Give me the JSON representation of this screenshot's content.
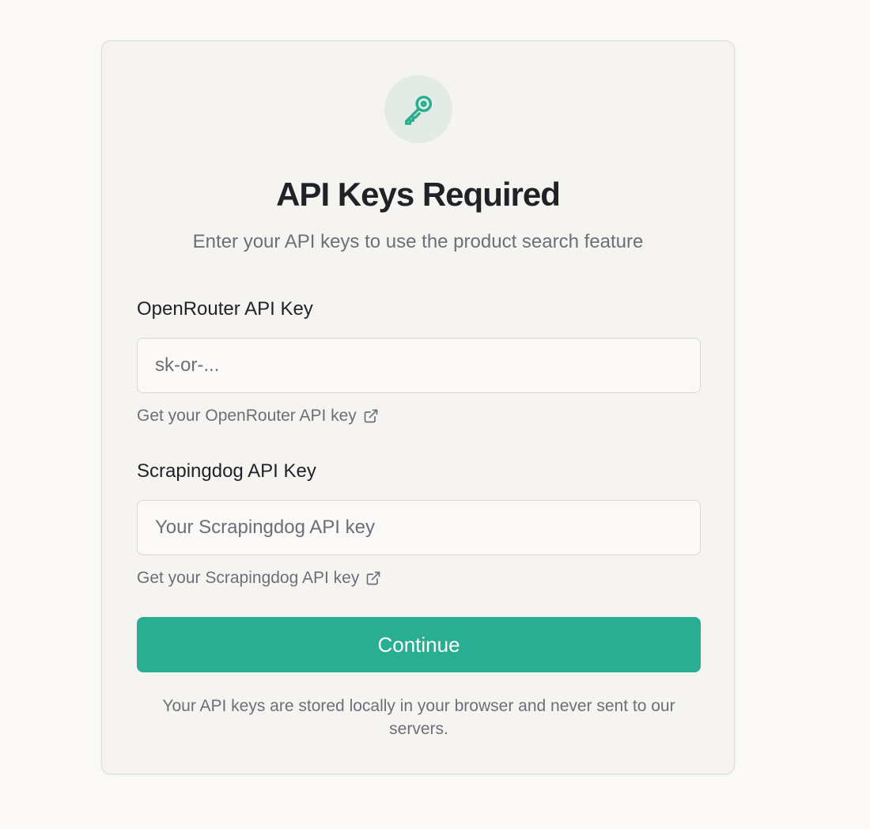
{
  "dialog": {
    "icon": "key-icon",
    "title": "API Keys Required",
    "subtitle": "Enter your API keys to use the product search feature"
  },
  "openrouter": {
    "label": "OpenRouter API Key",
    "value": "",
    "placeholder": "sk-or-...",
    "link_text": "Get your OpenRouter API key",
    "link_icon": "external-link-icon"
  },
  "scrapingdog": {
    "label": "Scrapingdog API Key",
    "value": "",
    "placeholder": "Your Scrapingdog API key",
    "link_text": "Get your Scrapingdog API key",
    "link_icon": "external-link-icon"
  },
  "continue_label": "Continue",
  "privacy_note": "Your API keys are stored locally in your browser and never sent to our servers.",
  "colors": {
    "accent": "#2aae92",
    "icon_bg": "#e3ebe6",
    "page_bg": "#faf9f7",
    "card_bg": "#f5f4f1",
    "title": "#1f2328",
    "muted": "#6b6f78"
  }
}
